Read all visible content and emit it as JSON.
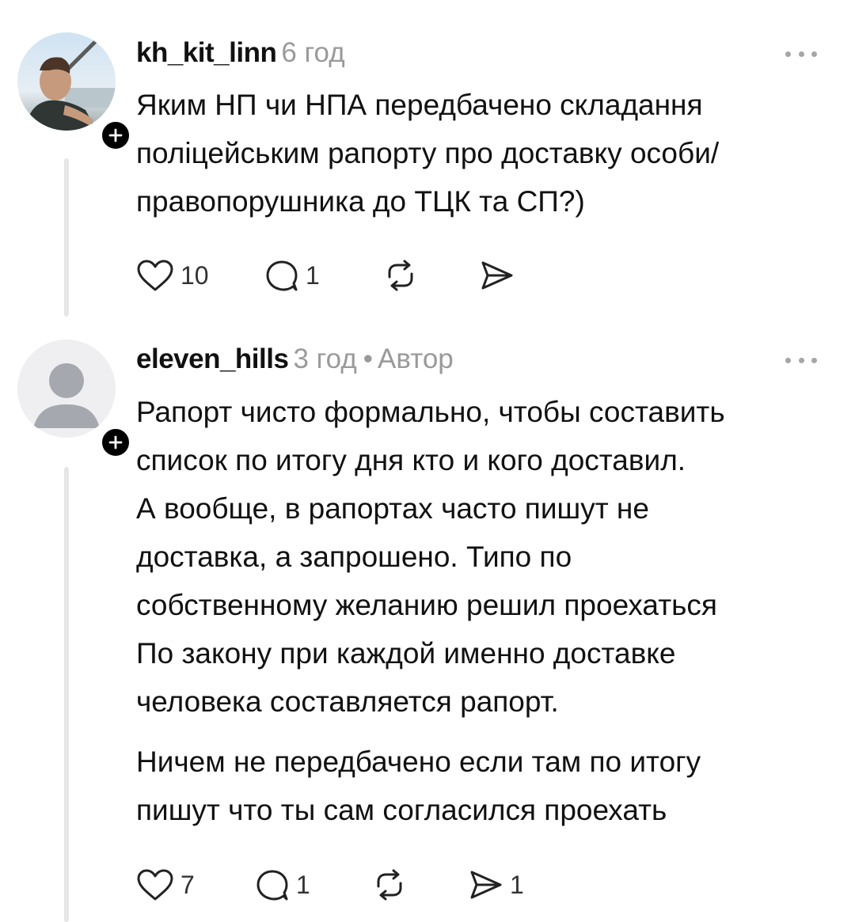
{
  "comments": [
    {
      "username": "kh_kit_linn",
      "time": "6 год",
      "author_badge": "",
      "text_lines": [
        "Яким НП чи НПА передбачено складання",
        "поліцейським рапорту про доставку особи/",
        "правопорушника до ТЦК та СП?)"
      ],
      "likes": "10",
      "replies": "1",
      "reposts": "",
      "shares": ""
    },
    {
      "username": "eleven_hills",
      "time": "3 год",
      "author_badge": "Автор",
      "text_lines": [
        "Рапорт чисто формально, чтобы составить",
        "список по итогу дня кто и кого доставил.",
        "А вообще, в рапортах часто пишут не",
        "доставка, а запрошено. Типо по",
        "собственному желанию решил проехаться",
        "По закону при каждой именно доставке",
        "человека составляется рапорт."
      ],
      "text_lines_2": [
        "Ничем не передбачено если там по итогу",
        "пишут что ты сам согласился проехать"
      ],
      "likes": "7",
      "replies": "1",
      "reposts": "",
      "shares": "1"
    }
  ],
  "icons": {
    "like": "heart-icon",
    "reply": "comment-icon",
    "repost": "repost-icon",
    "share": "send-icon",
    "more": "more-dots-icon",
    "follow": "plus-icon"
  },
  "colors": {
    "text": "#111111",
    "muted": "#9a9a9a",
    "thread_line": "#e6e6e6"
  }
}
